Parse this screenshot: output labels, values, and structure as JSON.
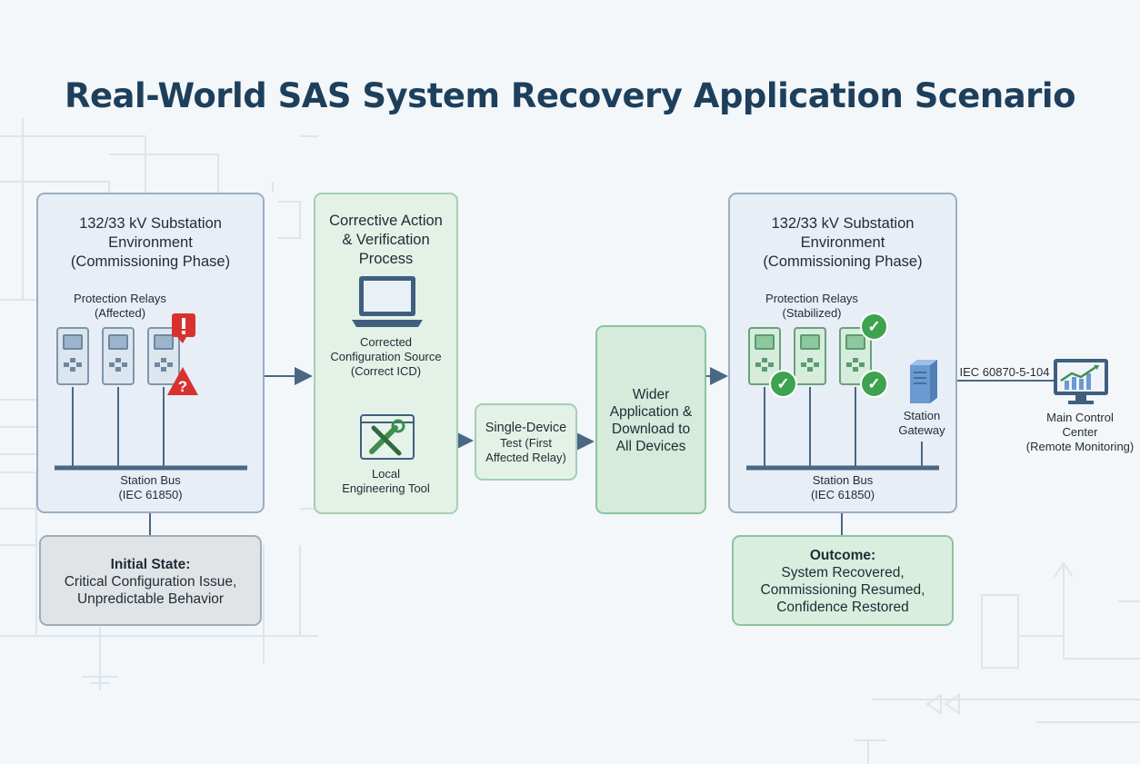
{
  "title": "Real-World SAS System Recovery Application Scenario",
  "colors": {
    "title": "#1d3f5c",
    "alert_red": "#d8322f",
    "ok_green": "#3ea34f",
    "connector": "#4a6784"
  },
  "left_panel": {
    "heading": [
      "132/33 kV Substation",
      "Environment",
      "(Commissioning Phase)"
    ],
    "relays_label": [
      "Protection Relays",
      "(Affected)"
    ],
    "bus_label": [
      "Station Bus",
      "(IEC 61850)"
    ],
    "icons": [
      "relay-icon",
      "alert-exclamation-icon",
      "warning-triangle-icon"
    ]
  },
  "initial_state": {
    "heading": "Initial State:",
    "lines": [
      "Critical Configuration Issue,",
      "Unpredictable Behavior"
    ]
  },
  "corrective_panel": {
    "heading": [
      "Corrective Action",
      "& Verification",
      "Process"
    ],
    "source_label": [
      "Corrected",
      "Configuration Source",
      "(Correct ICD)"
    ],
    "tool_label": [
      "Local",
      "Engineering Tool"
    ],
    "icons": [
      "laptop-icon",
      "engineering-tool-icon"
    ]
  },
  "single_test": {
    "lines": [
      "Single-Device",
      "Test (First",
      "Affected Relay)"
    ]
  },
  "wider_app": {
    "lines": [
      "Wider",
      "Application &",
      "Download to",
      "All Devices"
    ]
  },
  "right_panel": {
    "heading": [
      "132/33 kV Substation",
      "Environment",
      "(Commissioning Phase)"
    ],
    "relays_label": [
      "Protection Relays",
      "(Stabilized)"
    ],
    "gateway_label": [
      "Station",
      "Gateway"
    ],
    "bus_label": [
      "Station Bus",
      "(IEC 61850)"
    ],
    "icons": [
      "relay-icon",
      "check-icon",
      "server-icon"
    ]
  },
  "link_label": "IEC 60870-5-104",
  "control_center": {
    "lines": [
      "Main Control",
      "Center",
      "(Remote Monitoring)"
    ],
    "icon": "monitor-chart-icon"
  },
  "outcome": {
    "heading": "Outcome:",
    "lines": [
      "System Recovered,",
      "Commissioning Resumed,",
      "Confidence Restored"
    ]
  }
}
